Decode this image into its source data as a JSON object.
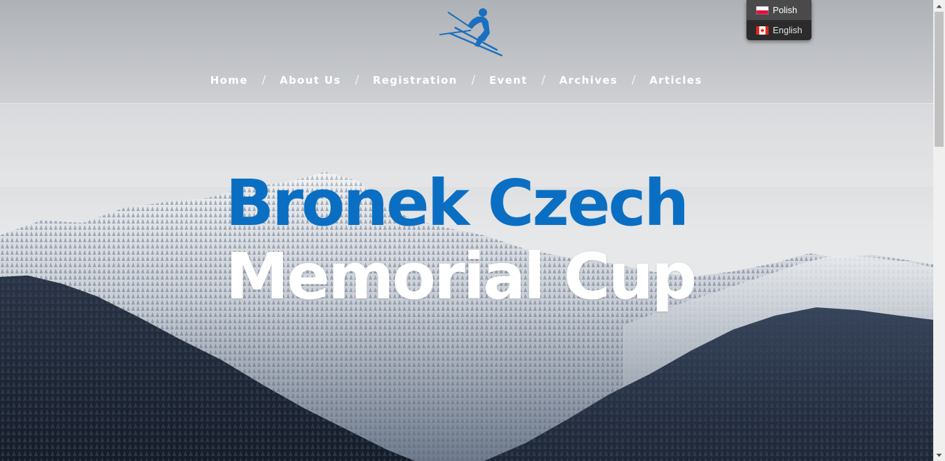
{
  "page": {
    "colors": {
      "accent_blue": "#0a6fc2",
      "title_white": "#ffffff",
      "sky_gray": "#cfd1d4",
      "forest_dark": "#1b2433",
      "menu_bg": "#3d3d3d"
    }
  },
  "logo": {
    "icon": "skier-logo-icon",
    "color": "#1a6fbf"
  },
  "nav": {
    "items": [
      {
        "label": "Home"
      },
      {
        "label": "About Us"
      },
      {
        "label": "Registration"
      },
      {
        "label": "Event"
      },
      {
        "label": "Archives"
      },
      {
        "label": "Articles"
      }
    ],
    "separator": "/"
  },
  "language_menu": {
    "items": [
      {
        "label": "Polish",
        "flag": "poland-flag-icon",
        "selected": true
      },
      {
        "label": "English",
        "flag": "canada-flag-icon",
        "selected": false
      }
    ]
  },
  "hero": {
    "title_line_1": "Bronek Czech",
    "title_line_2": "Memorial Cup"
  },
  "scrollbar": {
    "up_icon": "arrow-up-icon",
    "down_icon": "arrow-down-icon"
  }
}
